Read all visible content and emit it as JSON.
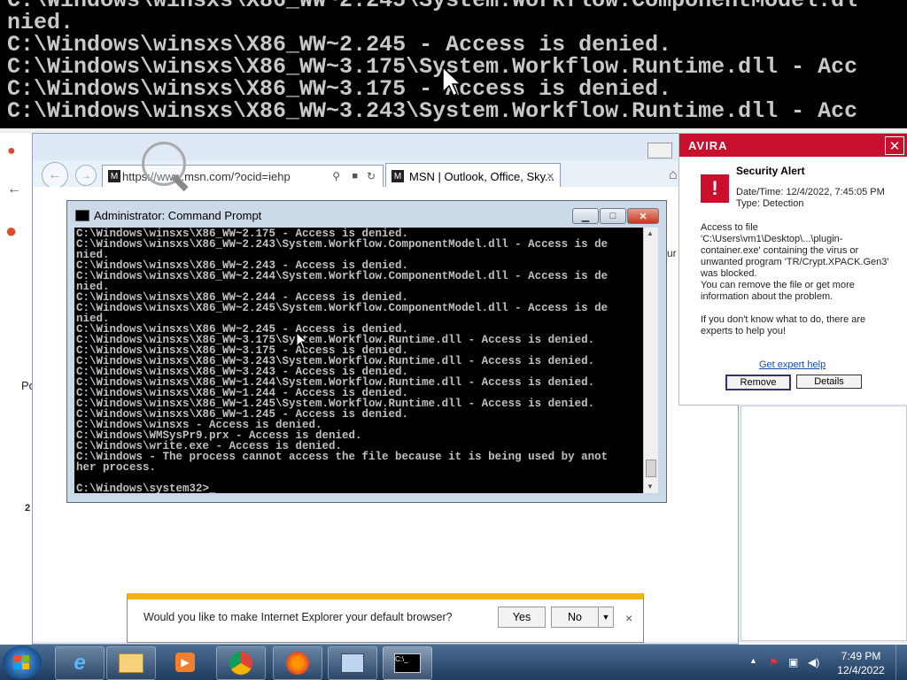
{
  "zoom_banner": {
    "lines": [
      "C:\\Windows\\winsxs\\X86_WW~2.245\\System.Workflow.ComponentModel.dl",
      "nied.",
      "C:\\Windows\\winsxs\\X86_WW~2.245 - Access is denied.",
      "C:\\Windows\\winsxs\\X86_WW~3.175\\System.Workflow.Runtime.dll - Acc",
      "C:\\Windows\\winsxs\\X86_WW~3.175 - Access is denied.",
      "C:\\Windows\\winsxs\\X86_WW~3.243\\System.Workflow.Runtime.dll - Acc"
    ]
  },
  "ie": {
    "address_url": "https://www.msn.com/?ocid=iehp",
    "tab_title": "MSN | Outlook, Office, Sky...",
    "tab_close": "✕",
    "back_glyph": "←",
    "forward_glyph": "→"
  },
  "cmd": {
    "title": "Administrator: Command Prompt",
    "console_lines": [
      "C:\\Windows\\winsxs\\X86_WW~2.175 - Access is denied.",
      "C:\\Windows\\winsxs\\X86_WW~2.243\\System.Workflow.ComponentModel.dll - Access is de",
      "nied.",
      "C:\\Windows\\winsxs\\X86_WW~2.243 - Access is denied.",
      "C:\\Windows\\winsxs\\X86_WW~2.244\\System.Workflow.ComponentModel.dll - Access is de",
      "nied.",
      "C:\\Windows\\winsxs\\X86_WW~2.244 - Access is denied.",
      "C:\\Windows\\winsxs\\X86_WW~2.245\\System.Workflow.ComponentModel.dll - Access is de",
      "nied.",
      "C:\\Windows\\winsxs\\X86_WW~2.245 - Access is denied.",
      "C:\\Windows\\winsxs\\X86_WW~3.175\\System.Workflow.Runtime.dll - Access is denied.",
      "C:\\Windows\\winsxs\\X86_WW~3.175 - Access is denied.",
      "C:\\Windows\\winsxs\\X86_WW~3.243\\System.Workflow.Runtime.dll - Access is denied.",
      "C:\\Windows\\winsxs\\X86_WW~3.243 - Access is denied.",
      "C:\\Windows\\winsxs\\X86_WW~1.244\\System.Workflow.Runtime.dll - Access is denied.",
      "C:\\Windows\\winsxs\\X86_WW~1.244 - Access is denied.",
      "C:\\Windows\\winsxs\\X86_WW~1.245\\System.Workflow.Runtime.dll - Access is denied.",
      "C:\\Windows\\winsxs\\X86_WW~1.245 - Access is denied.",
      "C:\\Windows\\winsxs - Access is denied.",
      "C:\\Windows\\WMSysPr9.prx - Access is denied.",
      "C:\\Windows\\write.exe - Access is denied.",
      "C:\\Windows - The process cannot access the file because it is being used by anot",
      "her process.",
      "",
      "C:\\Windows\\system32>_"
    ]
  },
  "avira": {
    "brand": "AVIRA",
    "close_glyph": "✕",
    "title": "Security Alert",
    "datetime": "Date/Time: 12/4/2022, 7:45:05 PM",
    "type": "Type: Detection",
    "message": "Access to file 'C:\\Users\\vm1\\Desktop\\...\\plugin-container.exe' containing the virus or unwanted program 'TR/Crypt.XPACK.Gen3' was blocked.",
    "remove_info": "You can remove the file or get more information about the problem.",
    "help_info": "If you don't know what to do, there are experts to help you!",
    "help_link": "Get expert help",
    "remove_btn": "Remove",
    "details_btn": "Details"
  },
  "default_browser": {
    "question": "Would you like to make Internet Explorer your default browser?",
    "yes": "Yes",
    "no": "No",
    "dropdown": "▼",
    "close": "×"
  },
  "bg_page": {
    "partial_text_1": "Po",
    "partial_text_2": "2",
    "partial_text_3": "ur i"
  },
  "taskbar": {
    "time": "7:49 PM",
    "date": "12/4/2022",
    "icons": [
      "ie-icon",
      "explorer-icon",
      "media-player-icon",
      "chrome-icon",
      "firefox-icon",
      "network-app-icon",
      "cmd-icon"
    ]
  }
}
